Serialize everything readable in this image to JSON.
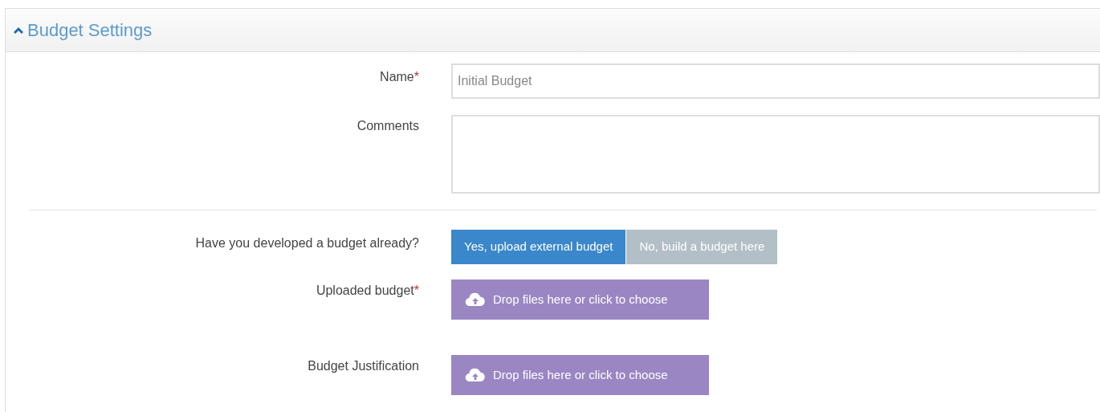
{
  "panel": {
    "title": "Budget Settings",
    "expanded": true
  },
  "fields": [
    {
      "kind": "text",
      "label": "Name",
      "required_mark": "*",
      "value": "Initial Budget"
    },
    {
      "kind": "textarea",
      "label": "Comments"
    }
  ],
  "question": {
    "label": "Have you developed a budget already?",
    "options": [
      {
        "label": "Yes, upload external budget",
        "selected": true
      },
      {
        "label": "No, build a budget here",
        "selected": false
      }
    ]
  },
  "uploads": [
    {
      "label": "Uploaded budget",
      "required_mark": "*",
      "text": "Drop files here or click to choose"
    },
    {
      "label": "Budget Justification",
      "text": "Drop files here or click to choose"
    }
  ]
}
